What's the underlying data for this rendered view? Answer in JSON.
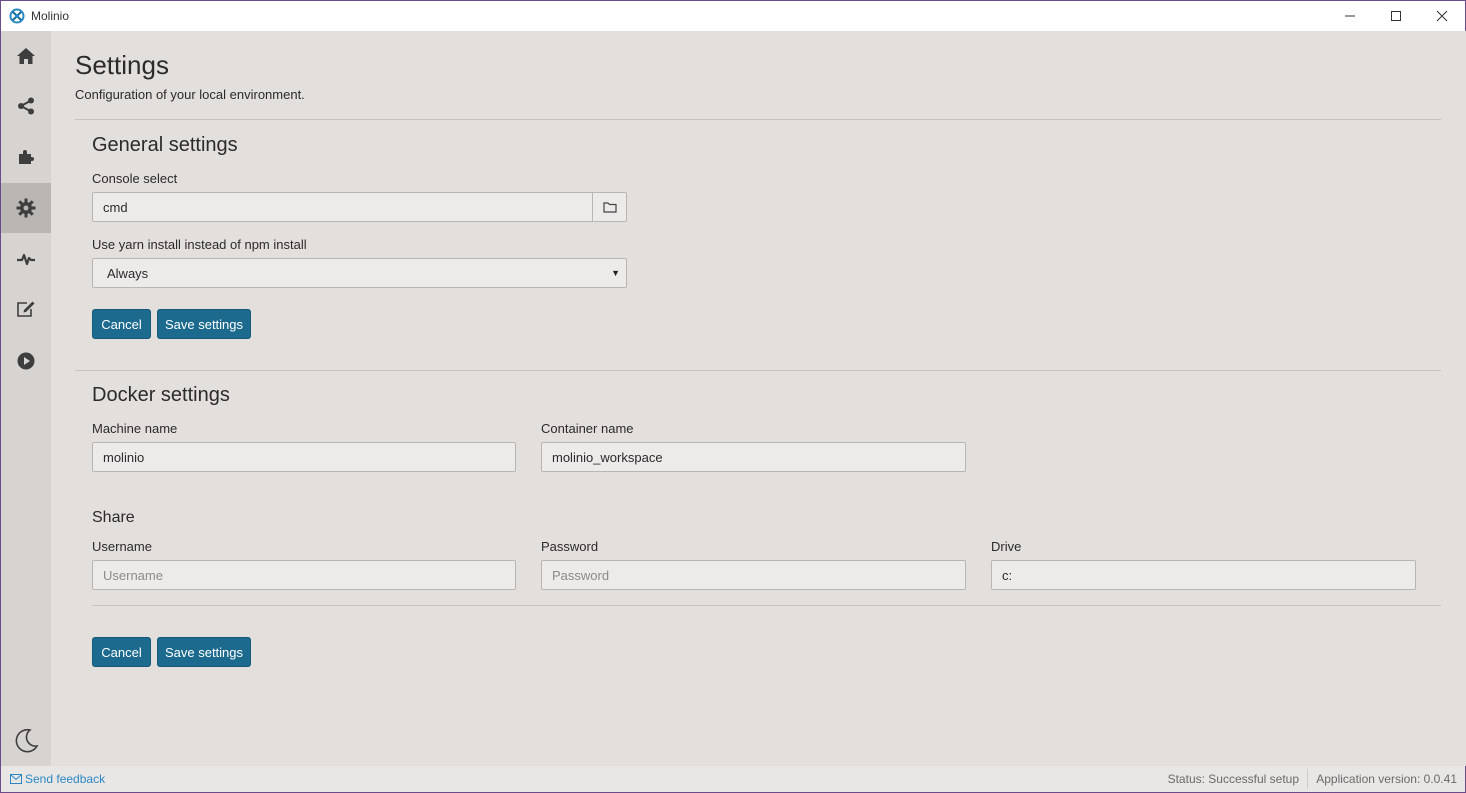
{
  "window": {
    "title": "Molinio"
  },
  "sidebar": {
    "items": [
      {
        "icon": "home-icon"
      },
      {
        "icon": "share-icon"
      },
      {
        "icon": "puzzle-icon"
      },
      {
        "icon": "gear-icon",
        "active": true
      },
      {
        "icon": "heartbeat-icon"
      },
      {
        "icon": "edit-icon"
      },
      {
        "icon": "play-circle-icon"
      }
    ],
    "bottom_icon": "moon-icon"
  },
  "page": {
    "title": "Settings",
    "subtitle": "Configuration of your local environment."
  },
  "general": {
    "title": "General settings",
    "console_label": "Console select",
    "console_value": "cmd",
    "yarn_label": "Use yarn install instead of npm install",
    "yarn_value": "Always",
    "cancel_label": "Cancel",
    "save_label": "Save settings"
  },
  "docker": {
    "title": "Docker settings",
    "machine_label": "Machine name",
    "machine_value": "molinio",
    "container_label": "Container name",
    "container_value": "molinio_workspace",
    "share_title": "Share",
    "username_label": "Username",
    "username_placeholder": "Username",
    "password_label": "Password",
    "password_placeholder": "Password",
    "drive_label": "Drive",
    "drive_value": "c:",
    "cancel_label": "Cancel",
    "save_label": "Save settings"
  },
  "statusbar": {
    "feedback": "Send feedback",
    "status": "Status: Successful setup",
    "version": "Application version: 0.0.41"
  },
  "colors": {
    "accent": "#1d6a8f",
    "link": "#2a88c4",
    "background": "#e2dfdd",
    "sidebar": "#d6d3d1"
  }
}
